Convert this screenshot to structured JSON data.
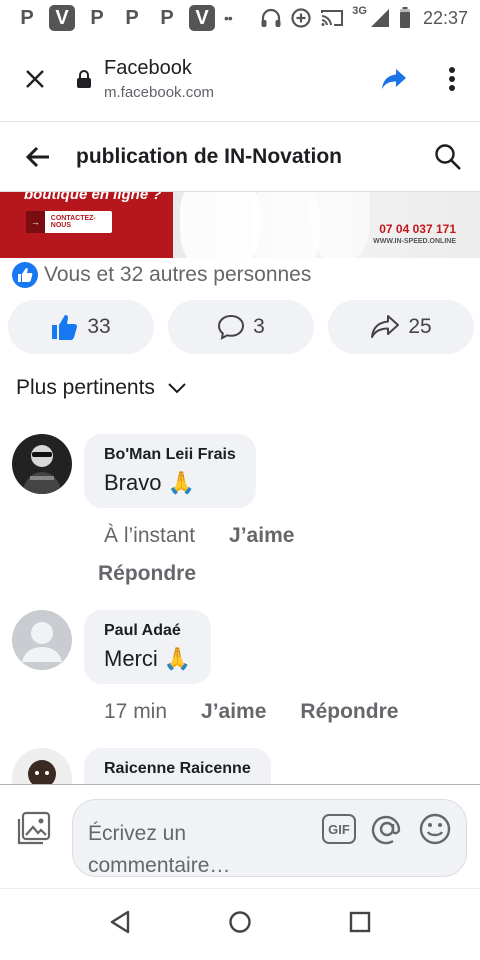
{
  "status_bar": {
    "apps": [
      "P",
      "V",
      "P",
      "P",
      "P",
      "V"
    ],
    "network": "3G",
    "time": "22:37"
  },
  "browser": {
    "title": "Facebook",
    "url": "m.facebook.com",
    "accent": "#1a73e8"
  },
  "header": {
    "title": "publication de IN-Novation"
  },
  "ad_banner": {
    "tagline": "boutique en ligne ?",
    "cta": "CONTACTEZ-NOUS",
    "phone": "07 04 037 171",
    "website": "WWW.IN-SPEED.ONLINE",
    "accent": "#b5171c"
  },
  "reactions": {
    "summary": "Vous et 32 autres personnes",
    "like_count": "33",
    "comment_count": "3",
    "share_count": "25"
  },
  "sort": {
    "label": "Plus pertinents"
  },
  "comments": [
    {
      "author": "Bo'Man Leii Frais",
      "text": "Bravo 🙏",
      "time": "À l’instant",
      "like_label": "J’aime",
      "reply_label": "Répondre"
    },
    {
      "author": "Paul Adaé",
      "text": "Merci 🙏",
      "time": "17 min",
      "like_label": "J’aime",
      "reply_label": "Répondre"
    },
    {
      "author": "Raicenne Raicenne"
    }
  ],
  "composer": {
    "placeholder_line1": "Écrivez un",
    "placeholder_line2": "commentaire…",
    "gif_label": "GIF"
  },
  "colors": {
    "facebook_blue": "#1877f2",
    "bubble_bg": "#f0f2f5",
    "secondary_text": "#65676b"
  }
}
